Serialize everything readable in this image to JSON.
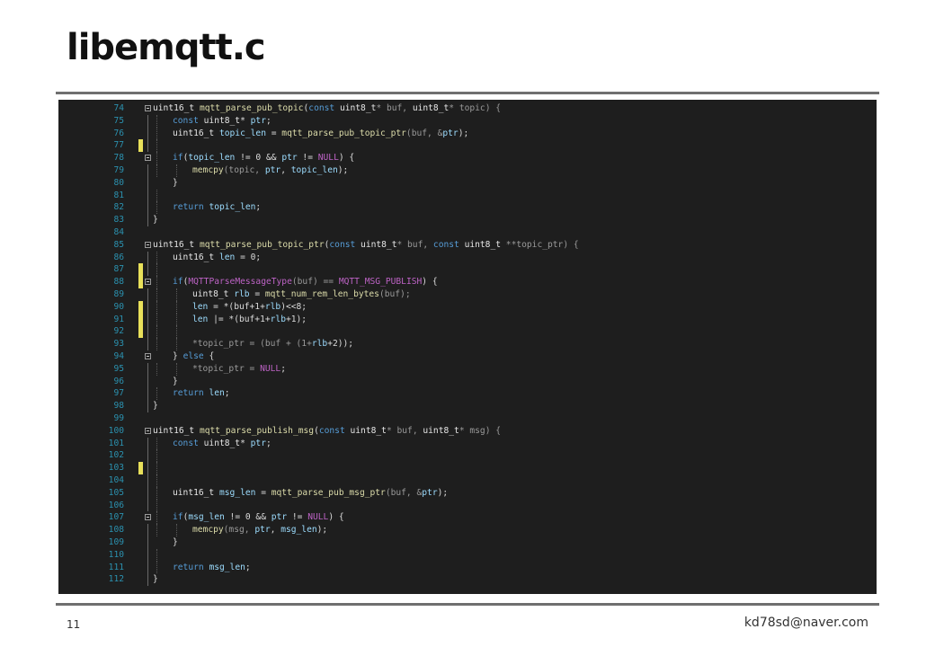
{
  "slide": {
    "title": "libemqtt.c",
    "page_number": "11",
    "email": "kd78sd@naver.com"
  },
  "colors": {
    "keyword": "#569cd6",
    "function": "#dcdcaa",
    "type": "#e6e6e6",
    "variable": "#9cdcfe",
    "macro": "#bd63c5",
    "plain": "#dcdcdc",
    "line_number": "#2b91af",
    "change_marker": "#e8e05a",
    "editor_bg": "#1e1e1e"
  },
  "code": {
    "lines": [
      {
        "n": "74",
        "fold": true,
        "indent": 0,
        "t": [
          [
            "uint16_t ",
            "ty"
          ],
          [
            "mqtt_parse_pub_topic",
            "fn"
          ],
          [
            "(",
            "plain"
          ],
          [
            "const ",
            "kw"
          ],
          [
            "uint8_t",
            "ty"
          ],
          [
            "* buf, ",
            "param"
          ],
          [
            "uint8_t",
            "ty"
          ],
          [
            "* topic) {",
            "param"
          ]
        ]
      },
      {
        "n": "75",
        "indent": 1,
        "t": [
          [
            "const ",
            "kw"
          ],
          [
            "uint8_t",
            "ty"
          ],
          [
            "* ",
            "plain"
          ],
          [
            "ptr",
            "var"
          ],
          [
            ";",
            "plain"
          ]
        ]
      },
      {
        "n": "76",
        "indent": 1,
        "t": [
          [
            "uint16_t ",
            "ty"
          ],
          [
            "topic_len",
            "var"
          ],
          [
            " = ",
            "plain"
          ],
          [
            "mqtt_parse_pub_topic_ptr",
            "fn"
          ],
          [
            "(buf, &",
            "param"
          ],
          [
            "ptr",
            "var"
          ],
          [
            ");",
            "plain"
          ]
        ]
      },
      {
        "n": "77",
        "mark": true,
        "indent": 1,
        "t": []
      },
      {
        "n": "78",
        "fold": true,
        "indent": 1,
        "t": [
          [
            "if",
            "kw"
          ],
          [
            "(",
            "plain"
          ],
          [
            "topic_len",
            "var"
          ],
          [
            " != 0 && ",
            "plain"
          ],
          [
            "ptr",
            "var"
          ],
          [
            " != ",
            "plain"
          ],
          [
            "NULL",
            "macro"
          ],
          [
            ") {",
            "plain"
          ]
        ]
      },
      {
        "n": "79",
        "indent": 2,
        "t": [
          [
            "memcpy",
            "fn"
          ],
          [
            "(topic, ",
            "param"
          ],
          [
            "ptr",
            "var"
          ],
          [
            ", ",
            "plain"
          ],
          [
            "topic_len",
            "var"
          ],
          [
            ");",
            "plain"
          ]
        ]
      },
      {
        "n": "80",
        "indent": 1,
        "t": [
          [
            "}",
            "plain"
          ]
        ]
      },
      {
        "n": "81",
        "indent": 1,
        "t": []
      },
      {
        "n": "82",
        "indent": 1,
        "t": [
          [
            "return ",
            "kw"
          ],
          [
            "topic_len",
            "var"
          ],
          [
            ";",
            "plain"
          ]
        ]
      },
      {
        "n": "83",
        "indent": 0,
        "t": [
          [
            "}",
            "plain"
          ]
        ]
      },
      {
        "n": "84",
        "indent": -1,
        "t": []
      },
      {
        "n": "85",
        "fold": true,
        "indent": 0,
        "t": [
          [
            "uint16_t ",
            "ty"
          ],
          [
            "mqtt_parse_pub_topic_ptr",
            "fn"
          ],
          [
            "(",
            "plain"
          ],
          [
            "const ",
            "kw"
          ],
          [
            "uint8_t",
            "ty"
          ],
          [
            "* buf, ",
            "param"
          ],
          [
            "const ",
            "kw"
          ],
          [
            "uint8_t ",
            "ty"
          ],
          [
            "**topic_ptr) {",
            "param"
          ]
        ]
      },
      {
        "n": "86",
        "indent": 1,
        "t": [
          [
            "uint16_t ",
            "ty"
          ],
          [
            "len",
            "var"
          ],
          [
            " = 0;",
            "plain"
          ]
        ]
      },
      {
        "n": "87",
        "mark": true,
        "indent": 1,
        "t": []
      },
      {
        "n": "88",
        "mark": true,
        "fold": true,
        "indent": 1,
        "t": [
          [
            "if",
            "kw"
          ],
          [
            "(",
            "plain"
          ],
          [
            "MQTTParseMessageType",
            "macro"
          ],
          [
            "(buf) == ",
            "param"
          ],
          [
            "MQTT_MSG_PUBLISH",
            "macro"
          ],
          [
            ") {",
            "plain"
          ]
        ]
      },
      {
        "n": "89",
        "indent": 2,
        "t": [
          [
            "uint8_t ",
            "ty"
          ],
          [
            "rlb",
            "var"
          ],
          [
            " = ",
            "plain"
          ],
          [
            "mqtt_num_rem_len_bytes",
            "fn"
          ],
          [
            "(buf);",
            "param"
          ]
        ]
      },
      {
        "n": "90",
        "mark": true,
        "indent": 2,
        "t": [
          [
            "len",
            "var"
          ],
          [
            " = *(buf+1+",
            "plain"
          ],
          [
            "rlb",
            "var"
          ],
          [
            ")<<8;",
            "plain"
          ]
        ]
      },
      {
        "n": "91",
        "mark": true,
        "indent": 2,
        "t": [
          [
            "len",
            "var"
          ],
          [
            " |= *(buf+1+",
            "plain"
          ],
          [
            "rlb",
            "var"
          ],
          [
            "+1);",
            "plain"
          ]
        ]
      },
      {
        "n": "92",
        "mark": true,
        "indent": 2,
        "t": []
      },
      {
        "n": "93",
        "indent": 2,
        "t": [
          [
            "*topic_ptr = (buf + (1+",
            "param"
          ],
          [
            "rlb",
            "var"
          ],
          [
            "+2));",
            "plain"
          ]
        ]
      },
      {
        "n": "94",
        "fold": true,
        "indent": 1,
        "t": [
          [
            "} ",
            "plain"
          ],
          [
            "else ",
            "kw"
          ],
          [
            "{",
            "plain"
          ]
        ]
      },
      {
        "n": "95",
        "indent": 2,
        "t": [
          [
            "*topic_ptr = ",
            "param"
          ],
          [
            "NULL",
            "macro"
          ],
          [
            ";",
            "plain"
          ]
        ]
      },
      {
        "n": "96",
        "indent": 1,
        "t": [
          [
            "}",
            "plain"
          ]
        ]
      },
      {
        "n": "97",
        "indent": 1,
        "t": [
          [
            "return ",
            "kw"
          ],
          [
            "len",
            "var"
          ],
          [
            ";",
            "plain"
          ]
        ]
      },
      {
        "n": "98",
        "indent": 0,
        "t": [
          [
            "}",
            "plain"
          ]
        ]
      },
      {
        "n": "99",
        "indent": -1,
        "t": []
      },
      {
        "n": "100",
        "fold": true,
        "indent": 0,
        "t": [
          [
            "uint16_t ",
            "ty"
          ],
          [
            "mqtt_parse_publish_msg",
            "fn"
          ],
          [
            "(",
            "plain"
          ],
          [
            "const ",
            "kw"
          ],
          [
            "uint8_t",
            "ty"
          ],
          [
            "* buf, ",
            "param"
          ],
          [
            "uint8_t",
            "ty"
          ],
          [
            "* msg) {",
            "param"
          ]
        ]
      },
      {
        "n": "101",
        "indent": 1,
        "t": [
          [
            "const ",
            "kw"
          ],
          [
            "uint8_t",
            "ty"
          ],
          [
            "* ",
            "plain"
          ],
          [
            "ptr",
            "var"
          ],
          [
            ";",
            "plain"
          ]
        ]
      },
      {
        "n": "102",
        "indent": 1,
        "t": []
      },
      {
        "n": "103",
        "mark": true,
        "indent": 1,
        "t": []
      },
      {
        "n": "104",
        "indent": 1,
        "t": []
      },
      {
        "n": "105",
        "indent": 1,
        "t": [
          [
            "uint16_t ",
            "ty"
          ],
          [
            "msg_len",
            "var"
          ],
          [
            " = ",
            "plain"
          ],
          [
            "mqtt_parse_pub_msg_ptr",
            "fn"
          ],
          [
            "(buf, &",
            "param"
          ],
          [
            "ptr",
            "var"
          ],
          [
            ");",
            "plain"
          ]
        ]
      },
      {
        "n": "106",
        "indent": 1,
        "t": []
      },
      {
        "n": "107",
        "fold": true,
        "indent": 1,
        "t": [
          [
            "if",
            "kw"
          ],
          [
            "(",
            "plain"
          ],
          [
            "msg_len",
            "var"
          ],
          [
            " != 0 && ",
            "plain"
          ],
          [
            "ptr",
            "var"
          ],
          [
            " != ",
            "plain"
          ],
          [
            "NULL",
            "macro"
          ],
          [
            ") {",
            "plain"
          ]
        ]
      },
      {
        "n": "108",
        "indent": 2,
        "t": [
          [
            "memcpy",
            "fn"
          ],
          [
            "(msg, ",
            "param"
          ],
          [
            "ptr",
            "var"
          ],
          [
            ", ",
            "plain"
          ],
          [
            "msg_len",
            "var"
          ],
          [
            ");",
            "plain"
          ]
        ]
      },
      {
        "n": "109",
        "indent": 1,
        "t": [
          [
            "}",
            "plain"
          ]
        ]
      },
      {
        "n": "110",
        "indent": 1,
        "t": []
      },
      {
        "n": "111",
        "indent": 1,
        "t": [
          [
            "return ",
            "kw"
          ],
          [
            "msg_len",
            "var"
          ],
          [
            ";",
            "plain"
          ]
        ]
      },
      {
        "n": "112",
        "indent": 0,
        "t": [
          [
            "}",
            "plain"
          ]
        ]
      }
    ]
  }
}
